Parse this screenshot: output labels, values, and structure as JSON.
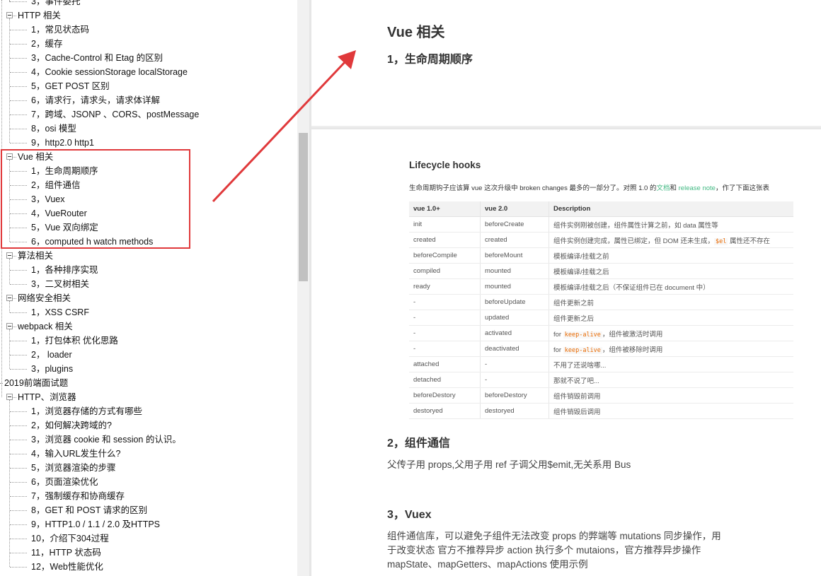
{
  "tree": {
    "items": [
      {
        "label": "3，事件委托",
        "level": 2
      },
      {
        "label": "HTTP 相关",
        "level": 1
      },
      {
        "label": "1，常见状态码",
        "level": 2
      },
      {
        "label": "2，缓存",
        "level": 2
      },
      {
        "label": "3，Cache-Control 和 Etag 的区别",
        "level": 2
      },
      {
        "label": "4，Cookie sessionStorage localStorage",
        "level": 2
      },
      {
        "label": "5，GET POST 区别",
        "level": 2
      },
      {
        "label": "6，请求行，请求头，请求体详解",
        "level": 2
      },
      {
        "label": "7，跨域、JSONP 、CORS、postMessage",
        "level": 2
      },
      {
        "label": "8，osi 模型",
        "level": 2
      },
      {
        "label": "9，http2.0 http1",
        "level": 2
      },
      {
        "label": "Vue 相关",
        "level": 1
      },
      {
        "label": "1，生命周期顺序",
        "level": 2
      },
      {
        "label": "2，组件通信",
        "level": 2
      },
      {
        "label": "3，Vuex",
        "level": 2
      },
      {
        "label": "4，VueRouter",
        "level": 2
      },
      {
        "label": "5，Vue 双向绑定",
        "level": 2
      },
      {
        "label": "6，computed h watch methods",
        "level": 2
      },
      {
        "label": "算法相关",
        "level": 1
      },
      {
        "label": "1，各种排序实现",
        "level": 2
      },
      {
        "label": "3，二叉树相关",
        "level": 2
      },
      {
        "label": "网络安全相关",
        "level": 1
      },
      {
        "label": "1，XSS CSRF",
        "level": 2
      },
      {
        "label": "webpack 相关",
        "level": 1
      },
      {
        "label": "1，打包体积 优化思路",
        "level": 2
      },
      {
        "label": "2， loader",
        "level": 2
      },
      {
        "label": "3，plugins",
        "level": 2
      },
      {
        "label": "2019前端面试题",
        "level": 0
      },
      {
        "label": "HTTP、浏览器",
        "level": 1
      },
      {
        "label": "1，浏览器存储的方式有哪些",
        "level": 2
      },
      {
        "label": "2，如何解决跨域的?",
        "level": 2
      },
      {
        "label": "3，浏览器 cookie 和 session 的认识。",
        "level": 2
      },
      {
        "label": "4，输入URL发生什么?",
        "level": 2
      },
      {
        "label": "5，浏览器渲染的步骤",
        "level": 2
      },
      {
        "label": "6，页面渲染优化",
        "level": 2
      },
      {
        "label": "7，强制缓存和协商缓存",
        "level": 2
      },
      {
        "label": "8，GET 和 POST 请求的区别",
        "level": 2
      },
      {
        "label": "9，HTTP1.0 / 1.1 / 2.0 及HTTPS",
        "level": 2
      },
      {
        "label": "10，介绍下304过程",
        "level": 2
      },
      {
        "label": "11，HTTP 状态码",
        "level": 2
      },
      {
        "label": "12，Web性能优化",
        "level": 2
      }
    ]
  },
  "doc": {
    "section_title": "Vue 相关",
    "lifecycle_heading": "1，生命周期顺序",
    "lifecycle_image": {
      "title": "Lifecycle hooks",
      "intro_prefix": "生命周期钩子应该算 vue 这次升级中 broken changes 最多的一部分了。对照 1.0 的",
      "intro_link1": "文档",
      "intro_mid": "和",
      "intro_link2": "release note",
      "intro_suffix": "，作了下面这张表",
      "link_color": "#42b983",
      "columns": [
        "vue 1.0+",
        "vue 2.0",
        "Description"
      ],
      "rows": [
        [
          "init",
          "beforeCreate",
          "组件实例刚被创建，组件属性计算之前，如 data 属性等"
        ],
        [
          "created",
          "created",
          "组件实例创建完成，属性已绑定，但 DOM 还未生成，$el 属性还不存在"
        ],
        [
          "beforeCompile",
          "beforeMount",
          "模板编译/挂载之前"
        ],
        [
          "compiled",
          "mounted",
          "模板编译/挂载之后"
        ],
        [
          "ready",
          "mounted",
          "模板编译/挂载之后（不保证组件已在 document 中）"
        ],
        [
          "-",
          "beforeUpdate",
          "组件更新之前"
        ],
        [
          "-",
          "updated",
          "组件更新之后"
        ],
        [
          "-",
          "activated",
          "for keep-alive，组件被激活时调用"
        ],
        [
          "-",
          "deactivated",
          "for keep-alive，组件被移除时调用"
        ],
        [
          "attached",
          "-",
          "不用了还说啥哪..."
        ],
        [
          "detached",
          "-",
          "那就不说了吧..."
        ],
        [
          "beforeDestory",
          "beforeDestory",
          "组件销毁前调用"
        ],
        [
          "destoryed",
          "destoryed",
          "组件销毁后调用"
        ]
      ]
    },
    "communication_heading": "2，组件通信",
    "communication_text": "父传子用 props,父用子用 ref 子调父用$emit,无关系用 Bus",
    "vuex_heading": "3，Vuex",
    "vuex_line1": "组件通信库，可以避免子组件无法改变 props 的弊端等 mutations 同步操作，用",
    "vuex_line2": "于改变状态 官方不推荐异步 action 执行多个 mutaions，官方推荐异步操作",
    "vuex_line3": "mapState、mapGetters、mapActions 使用示例"
  },
  "annotation": {
    "color": "#e0393b"
  }
}
